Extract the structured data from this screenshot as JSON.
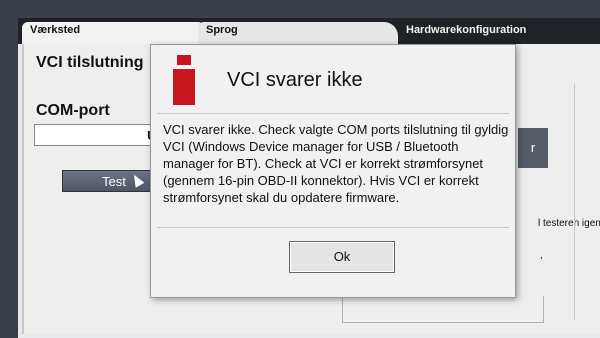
{
  "tabs": [
    {
      "label": "Værksted"
    },
    {
      "label": "Sprog"
    },
    {
      "label": "Hardwarekonfiguration"
    }
  ],
  "main": {
    "vci_connection_label": "VCI tilslutning",
    "com_port_label": "COM-port",
    "com_port_value": "Uke",
    "test_button": "Test",
    "side_button_char": "r",
    "background_text": "l testeren igen.",
    "comma": ","
  },
  "dialog": {
    "title": "VCI svarer ikke",
    "message": "VCI svarer ikke. Check valgte COM ports tilslutning til gyldig VCI (Windows Device manager for USB / Bluetooth manager for BT). Check at VCI er korrekt strømforsynet (gennem 16-pin OBD-II konnektor). Hvis VCI er korrekt strømforsynet skal du opdatere firmware.",
    "ok_button": "Ok",
    "icon": "info-icon",
    "icon_color": "#c8161e"
  }
}
